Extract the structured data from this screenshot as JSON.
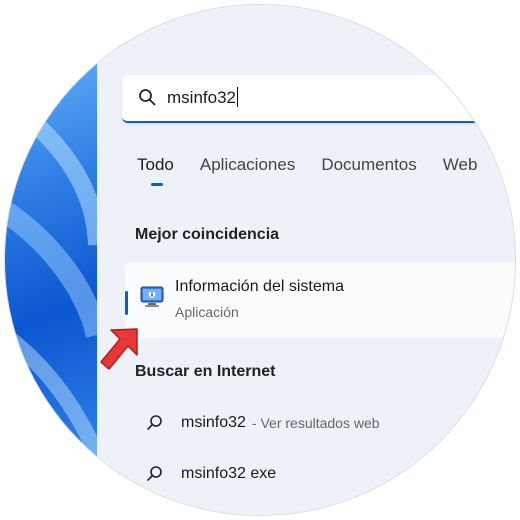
{
  "search": {
    "query": "msinfo32"
  },
  "tabs": [
    {
      "label": "Todo",
      "active": true
    },
    {
      "label": "Aplicaciones"
    },
    {
      "label": "Documentos"
    },
    {
      "label": "Web"
    }
  ],
  "best_match": {
    "heading": "Mejor coincidencia",
    "title": "Información del sistema",
    "subtitle": "Aplicación",
    "icon": "system-information-icon"
  },
  "web_search": {
    "heading": "Buscar en Internet",
    "items": [
      {
        "text": "msinfo32",
        "hint": "- Ver resultados web",
        "icon": "search-icon"
      },
      {
        "text": "msinfo32 exe",
        "hint": "",
        "icon": "search-icon"
      }
    ]
  },
  "colors": {
    "accent": "#0b5ec9",
    "pointer_arrow": "#e53935"
  }
}
